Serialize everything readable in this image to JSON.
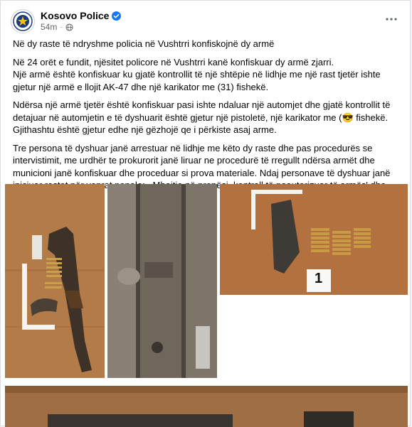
{
  "post": {
    "author": "Kosovo Police",
    "time": "54m",
    "icons": {
      "avatar": "police-badge-icon",
      "verified": "verified-badge-icon",
      "privacy": "globe-icon",
      "more": "more-options-icon"
    },
    "colors": {
      "verified": "#1877f2",
      "meta_text": "#65676b"
    }
  },
  "content": {
    "headline": "Në dy  raste të ndryshme policia në Vushtrri  konfiskojnë dy armë",
    "p1_line1": "Në  24 orët e fundit, njësitet policore në  Vushtrri  kanë konfiskuar dy  armë zjarri.",
    "p1_line2": "Një armë është konfiskuar ku gjatë kontrollit të një shtëpie në lidhje me një rast tjetër ishte gjetur një armë e llojit AK-47 dhe një karikator me (31) fishekë.",
    "p2_text": "Ndërsa një armë tjetër është konfiskuar pasi ishte ndaluar një automjet dhe gjatë kontrollit të detajuar në automjetin e të dyshuarit është gjetur një pistoletë, një karikator  me (",
    "p2_emoji": "😎",
    "p2_text_after": " fishekë. Gjithashtu është gjetur edhe një gëzhojë qe i përkiste asaj arme.",
    "p3": "Tre persona të dyshuar janë arrestuar në lidhje me këto dy raste dhe pas procedurës se intervistimit, me urdhër te prokurorit janë liruar ne procedurë të rregullt ndërsa armët dhe municioni janë konfiskuar dhe proceduar si prova materiale.  Ndaj personave të dyshuar janë iniciuar rastet për veprat penale:  ,,Mbajtje në pronësi, kontroll të paautorizuar të armës' dhe ,,Përdorim i armës\"."
  },
  "photos": {
    "evidence_marker": "1"
  }
}
